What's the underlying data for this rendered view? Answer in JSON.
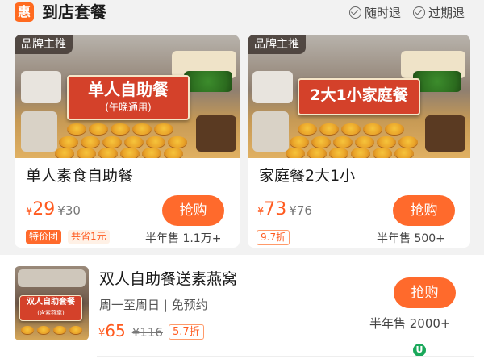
{
  "header": {
    "badge_icon": "惠",
    "title": "到店套餐",
    "tag1": "随时退",
    "tag2": "过期退"
  },
  "colors": {
    "accent": "#ff6a2c",
    "price": "#ff5a1f"
  },
  "cards": [
    {
      "badge": "品牌主推",
      "banner_main": "单人自助餐",
      "banner_sub": "(午晚通用)",
      "title": "单人素食自助餐",
      "price_symbol": "¥",
      "price": "29",
      "original_price": "¥30",
      "chip1": "特价团",
      "chip2": "共省1元",
      "buy_label": "抢购",
      "sold": "半年售 1.1万+"
    },
    {
      "badge": "品牌主推",
      "banner_main": "2大1小家庭餐",
      "title": "家庭餐2大1小",
      "price_symbol": "¥",
      "price": "73",
      "original_price": "¥76",
      "discount": "9.7折",
      "buy_label": "抢购",
      "sold": "半年售 500+"
    }
  ],
  "list_item": {
    "thumb_text": "双人自助套餐",
    "thumb_sub": "(含素燕窝)",
    "title": "双人自助餐送素燕窝",
    "subtitle": "周一至周日 | 免预约",
    "price_symbol": "¥",
    "price": "65",
    "original_price": "¥116",
    "discount": "5.7折",
    "buy_label": "抢购",
    "sold": "半年售 2000+"
  }
}
